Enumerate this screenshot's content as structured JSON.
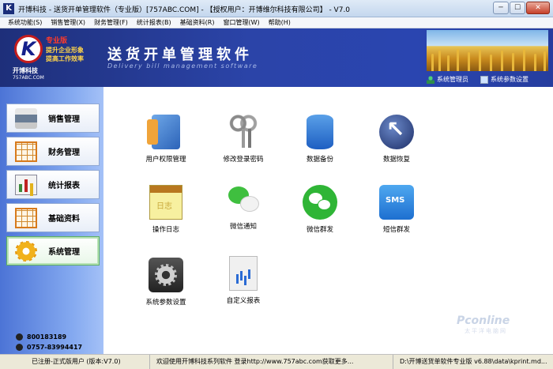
{
  "window": {
    "title": "开博科技 - 送货开单管理软件（专业版）[757ABC.COM] - 【授权用户：开博维尔科技有限公司】 - V7.0",
    "app_icon_letter": "K",
    "minimize_label": "─",
    "maximize_label": "☐",
    "close_label": "✕"
  },
  "menu": [
    {
      "label": "系统功能(S)"
    },
    {
      "label": "销售管理(X)"
    },
    {
      "label": "财务管理(F)"
    },
    {
      "label": "统计报表(B)"
    },
    {
      "label": "基础资料(R)"
    },
    {
      "label": "窗口管理(W)"
    },
    {
      "label": "帮助(H)"
    }
  ],
  "banner": {
    "logo_letter": "K",
    "edition": "专业版",
    "slogan1": "提升企业形象",
    "slogan2": "提高工作效率",
    "company": "开博科技",
    "url": "757ABC.COM",
    "title": "送货开单管理软件",
    "subtitle": "Delivery bill management software",
    "user_label": "系统管理员",
    "settings_label": "系统参数设置"
  },
  "sidebar": {
    "items": [
      {
        "label": "销售管理",
        "icon": "printer-icon"
      },
      {
        "label": "财务管理",
        "icon": "grid-icon"
      },
      {
        "label": "统计报表",
        "icon": "bar-chart-icon"
      },
      {
        "label": "基础资料",
        "icon": "grid-icon"
      },
      {
        "label": "系统管理",
        "icon": "gear-icon",
        "active": true
      }
    ],
    "phone1": "800183189",
    "phone2": "0757-83994417"
  },
  "tiles": [
    {
      "label": "用户权限管理",
      "icon": "users-icon"
    },
    {
      "label": "修改登录密码",
      "icon": "keys-icon"
    },
    {
      "label": "数据备份",
      "icon": "database-icon"
    },
    {
      "label": "数据恢复",
      "icon": "restore-icon"
    },
    {
      "label": "操作日志",
      "icon": "log-icon"
    },
    {
      "label": "微信通知",
      "icon": "wechat-icon"
    },
    {
      "label": "微信群发",
      "icon": "wechat-group-icon"
    },
    {
      "label": "短信群发",
      "icon": "sms-icon"
    },
    {
      "label": "系统参数设置",
      "icon": "settings-icon"
    },
    {
      "label": "自定义报表",
      "icon": "report-icon"
    }
  ],
  "watermark": {
    "main": "Pconline",
    "sub": "太平洋电脑网"
  },
  "status": {
    "reg": "已注册-正式版用户 (版本:V7.0)",
    "welcome": "欢迎使用开博科技系列软件  登录http://www.757abc.com获取更多...",
    "path": "D:\\开博送货单软件专业版 v6.88\\data\\kprint.md..."
  }
}
